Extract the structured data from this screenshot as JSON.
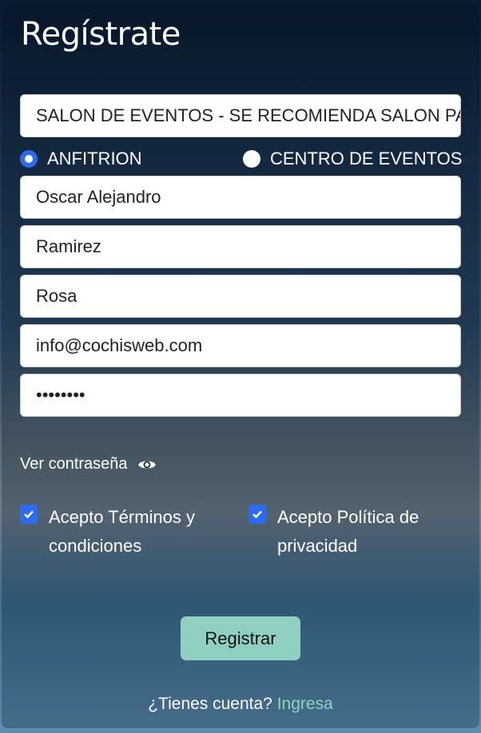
{
  "title": "Regístrate",
  "fields": {
    "venue_type": "SALON DE EVENTOS - SE RECOMIENDA SALON PARA",
    "first_name": "Oscar Alejandro",
    "last_name": "Ramirez",
    "second_last_name": "Rosa",
    "email": "info@cochisweb.com",
    "password": "••••••••"
  },
  "roles": [
    {
      "label": "ANFITRION",
      "selected": true
    },
    {
      "label": "CENTRO DE EVENTOS",
      "selected": false
    }
  ],
  "show_password": "Ver contraseña",
  "terms": {
    "label": "Acepto Términos y condiciones",
    "checked": true
  },
  "privacy": {
    "label": "Acepto Política de privacidad",
    "checked": true
  },
  "submit": "Registrar",
  "footer": {
    "text": "¿Tienes cuenta?",
    "link": "Ingresa"
  },
  "colors": {
    "accent": "#2d6cf0",
    "button": "#90cfc2",
    "link": "#8fd3c0"
  }
}
